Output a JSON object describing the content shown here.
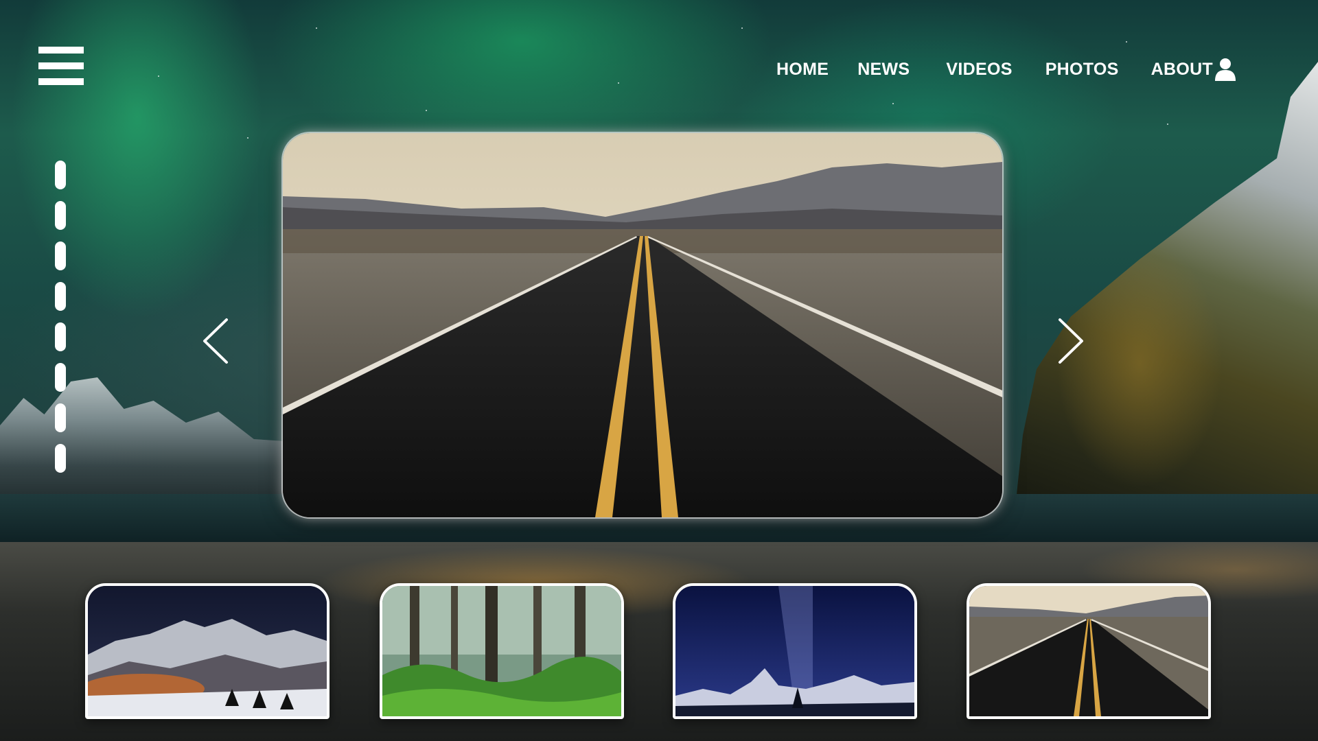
{
  "nav": {
    "items": [
      {
        "label": "HOME"
      },
      {
        "label": "NEWS"
      },
      {
        "label": "VIDEOS"
      },
      {
        "label": "PHOTOS"
      },
      {
        "label": "ABOUT"
      }
    ],
    "icons": {
      "menu": "hamburger-menu-icon",
      "user": "user-icon"
    }
  },
  "slider": {
    "main_image": "desert-road",
    "prev_icon": "chevron-left-icon",
    "next_icon": "chevron-right-icon",
    "dash_count": 8
  },
  "thumbnails": [
    {
      "image": "snowy-mountains-night"
    },
    {
      "image": "mossy-forest"
    },
    {
      "image": "milky-way-mountains"
    },
    {
      "image": "desert-road"
    }
  ],
  "colors": {
    "text": "#ffffff",
    "aurora": "#2fc27a",
    "road": "#111111",
    "road_line": "#d8a544"
  }
}
